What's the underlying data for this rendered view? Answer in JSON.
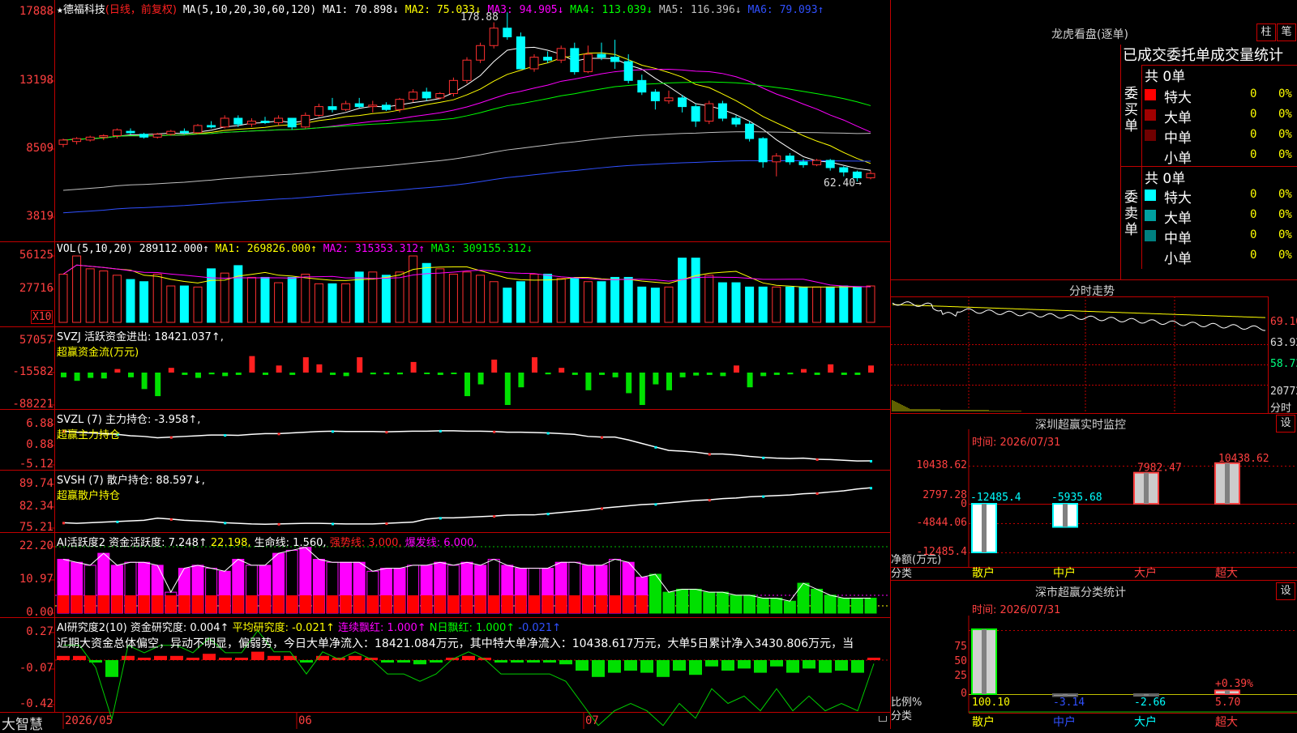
{
  "stock": {
    "star": "★",
    "name": "德福科技",
    "mode": "(日线，前复权)"
  },
  "ma_header": {
    "label": "MA(5,10,20,30,60,120)",
    "items": [
      {
        "text": "MA1: 70.898↓",
        "color": "#ffffff"
      },
      {
        "text": "MA2: 75.033↓",
        "color": "#ffff00"
      },
      {
        "text": "MA3: 94.905↓",
        "color": "#ff00ff"
      },
      {
        "text": "MA4: 113.039↓",
        "color": "#00ff00"
      },
      {
        "text": "MA5: 116.396↓",
        "color": "#c0c0c0"
      },
      {
        "text": "MA6: 79.093↑",
        "color": "#3050ff"
      }
    ]
  },
  "price_axis": [
    "17888",
    "13198",
    "8509",
    "3819"
  ],
  "price_high_mark": "178.88",
  "price_low_mark": "62.40→",
  "vol": {
    "label": "VOL(5,10,20)",
    "value": "289112.000↑",
    "ma1": "MA1: 269826.000↑",
    "ma2": "MA2: 315353.312↑",
    "ma3": "MA3: 309155.312↓",
    "axis": [
      "56125",
      "27716"
    ],
    "unit": "X10"
  },
  "svzj": {
    "label": "SVZJ  活跃资金进出: 18421.037↑,",
    "sub": "超赢资金流(万元)",
    "axis": [
      "57057",
      "-15582",
      "-88221"
    ]
  },
  "svzl": {
    "label": "SVZL (7) 主力持仓: -3.958↑,",
    "sub": "超赢主力持仓",
    "axis": [
      "6.88",
      "0.88",
      "-5.12"
    ]
  },
  "svsh": {
    "label": "SVSH (7) 散户持仓: 88.597↓,",
    "sub": "超赢散户持仓",
    "axis": [
      "89.74",
      "82.34",
      "75.21"
    ]
  },
  "ai_active": {
    "label": "AI活跃度2 资金活跃度: 7.248↑",
    "v2": "22.198,",
    "life": "生命线: 1.560,",
    "strong": "强势线: 3.000,",
    "burst": "爆发线: 6.000,",
    "axis": [
      "22.20",
      "10.97",
      "0.00"
    ]
  },
  "ai_research": {
    "label": "AI研究度2(10) 资金研究度: 0.004↑",
    "avg": "平均研究度: -0.021↑",
    "red": "连续飘红: 1.000↑",
    "nred": "N日飘红: 1.000↑",
    "last": "-0.021↑",
    "summary": "近期大资金总体偏空，异动不明显，偏弱势，今日大单净流入：18421.084万元，其中特大单净流入：10438.617万元，大单5日累计净入3430.806万元，当",
    "axis": [
      "0.27",
      "-0.07",
      "-0.42"
    ]
  },
  "bottom": {
    "brand": "大智慧",
    "dates": [
      "2026/05",
      "06",
      "07"
    ]
  },
  "dragon": {
    "title": "龙虎看盘(逐单)",
    "btn1": "柱",
    "btn2": "笔",
    "header": "已成交委托单成交量统计",
    "buy_label": "委买单",
    "sell_label": "委卖单",
    "buy_total": "共 0单",
    "sell_total": "共 0单",
    "buy_rows": [
      {
        "name": "特大",
        "qty": "0",
        "pct": "0%",
        "color": "#ff0000"
      },
      {
        "name": "大单",
        "qty": "0",
        "pct": "0%",
        "color": "#a00000"
      },
      {
        "name": "中单",
        "qty": "0",
        "pct": "0%",
        "color": "#700000"
      },
      {
        "name": "小单",
        "qty": "0",
        "pct": "0%",
        "color": "#000000"
      }
    ],
    "sell_rows": [
      {
        "name": "特大",
        "qty": "0",
        "pct": "0%",
        "color": "#00ffff"
      },
      {
        "name": "大单",
        "qty": "0",
        "pct": "0%",
        "color": "#00a0a0"
      },
      {
        "name": "中单",
        "qty": "0",
        "pct": "0%",
        "color": "#008080"
      },
      {
        "name": "小单",
        "qty": "0",
        "pct": "0%",
        "color": "#000000"
      }
    ]
  },
  "intraday": {
    "title": "分时走势",
    "axis": [
      "69.10",
      "63.92",
      "58.73",
      "20772"
    ],
    "label": "分时"
  },
  "monitor": {
    "title": "深圳超赢实时监控",
    "set": "设",
    "time": "时间: 2026/07/31",
    "axis": [
      "10438.62",
      "2797.28",
      "0",
      "-4844.06",
      "-12485.4"
    ],
    "net_label": "净额(万元)",
    "cat_label": "分类",
    "cats": [
      "散户",
      "中户",
      "大户",
      "超大"
    ],
    "values": [
      -12485.4,
      -5935.68,
      7982.47,
      10438.62
    ],
    "value_labels": [
      "-12485.4",
      "-5935.68",
      "7982.47",
      "10438.62"
    ]
  },
  "classify": {
    "title": "深市超赢分类统计",
    "set": "设",
    "time": "时间: 2026/07/31",
    "axis": [
      "75",
      "50",
      "25",
      "0"
    ],
    "ratio_label": "比例%",
    "cat_label": "分类",
    "cats": [
      "散户",
      "中户",
      "大户",
      "超大"
    ],
    "values": [
      100.1,
      -3.14,
      -2.66,
      5.7
    ],
    "value_labels": [
      "100.10",
      "-3.14",
      "-2.66",
      "5.70"
    ],
    "extra": "+0.39%"
  },
  "chart_data": [
    {
      "type": "candlestick",
      "title": "德福科技 (日线，前复权)",
      "ylim": [
        38,
        179
      ],
      "xlabels": [
        "2026/05",
        "06",
        "07"
      ],
      "ohlc": [
        [
          88,
          92,
          86,
          91
        ],
        [
          90,
          93,
          88,
          92
        ],
        [
          91,
          94,
          90,
          93
        ],
        [
          93,
          95,
          91,
          94
        ],
        [
          94,
          99,
          92,
          98
        ],
        [
          97,
          99,
          95,
          96
        ],
        [
          95,
          96,
          92,
          93
        ],
        [
          93,
          96,
          92,
          95
        ],
        [
          95,
          98,
          94,
          97
        ],
        [
          97,
          99,
          95,
          96
        ],
        [
          96,
          102,
          95,
          101
        ],
        [
          101,
          104,
          99,
          100
        ],
        [
          100,
          108,
          99,
          106
        ],
        [
          106,
          108,
          100,
          102
        ],
        [
          102,
          106,
          100,
          104
        ],
        [
          104,
          107,
          102,
          103
        ],
        [
          103,
          108,
          101,
          106
        ],
        [
          106,
          104,
          98,
          100
        ],
        [
          100,
          110,
          99,
          108
        ],
        [
          108,
          116,
          107,
          114
        ],
        [
          114,
          120,
          110,
          112
        ],
        [
          112,
          118,
          111,
          116
        ],
        [
          116,
          120,
          113,
          114
        ],
        [
          114,
          118,
          110,
          115
        ],
        [
          115,
          117,
          111,
          112
        ],
        [
          112,
          120,
          110,
          119
        ],
        [
          119,
          126,
          117,
          124
        ],
        [
          124,
          127,
          118,
          120
        ],
        [
          120,
          124,
          119,
          123
        ],
        [
          123,
          134,
          121,
          132
        ],
        [
          132,
          148,
          130,
          146
        ],
        [
          146,
          158,
          144,
          156
        ],
        [
          156,
          172,
          154,
          168
        ],
        [
          168,
          178.88,
          160,
          162
        ],
        [
          162,
          165,
          140,
          140
        ],
        [
          140,
          150,
          138,
          148
        ],
        [
          148,
          152,
          144,
          146
        ],
        [
          146,
          156,
          144,
          154
        ],
        [
          154,
          158,
          136,
          138
        ],
        [
          138,
          156,
          137,
          150
        ],
        [
          150,
          158,
          146,
          148
        ],
        [
          148,
          160,
          140,
          145
        ],
        [
          145,
          150,
          130,
          132
        ],
        [
          132,
          136,
          122,
          124
        ],
        [
          124,
          126,
          112,
          118
        ],
        [
          118,
          125,
          116,
          120
        ],
        [
          120,
          122,
          110,
          114
        ],
        [
          114,
          116,
          100,
          104
        ],
        [
          104,
          118,
          102,
          116
        ],
        [
          116,
          118,
          104,
          106
        ],
        [
          106,
          108,
          100,
          102
        ],
        [
          102,
          104,
          90,
          92
        ],
        [
          92,
          93,
          72,
          76
        ],
        [
          76,
          82,
          66,
          80
        ],
        [
          80,
          82,
          74,
          76
        ],
        [
          76,
          78,
          72,
          74
        ],
        [
          74,
          78,
          73,
          77
        ],
        [
          77,
          78,
          70,
          72
        ],
        [
          72,
          73,
          66,
          69
        ],
        [
          69,
          70,
          62.4,
          65
        ],
        [
          65,
          70,
          64,
          68
        ]
      ]
    },
    {
      "type": "bar",
      "title": "VOL(5,10,20)",
      "values": [
        45,
        62,
        50,
        48,
        44,
        40,
        38,
        45,
        34,
        34,
        33,
        50,
        46,
        53,
        42,
        42,
        37,
        42,
        45,
        36,
        36,
        36,
        47,
        47,
        44,
        47,
        62,
        55,
        50,
        45,
        47,
        44,
        38,
        32,
        38,
        45,
        45,
        41,
        41,
        38,
        38,
        42,
        42,
        33,
        32,
        33,
        60,
        60,
        44,
        37,
        37,
        33,
        33,
        33,
        33,
        33,
        33,
        33,
        34,
        33,
        34
      ]
    },
    {
      "type": "bar",
      "title": "SVZJ 活跃资金进出",
      "values": [
        -8000,
        -14000,
        -9000,
        -10000,
        6000,
        -8000,
        -28000,
        -40000,
        8000,
        -4000,
        -9000,
        -3000,
        -6000,
        -4000,
        28000,
        -4000,
        12000,
        -4000,
        26000,
        14000,
        -4000,
        -6000,
        26000,
        -3000,
        -3000,
        -3000,
        18000,
        -2000,
        -4000,
        -2000,
        -40000,
        -20000,
        22000,
        -55000,
        -25000,
        26000,
        -3000,
        8000,
        -4000,
        -30000,
        -4000,
        -8000,
        -35000,
        -55000,
        -20000,
        -30000,
        -8000,
        -5000,
        -4000,
        -6000,
        12000,
        -25000,
        -6000,
        -4000,
        -3000,
        6000,
        -4000,
        14000,
        -4000,
        -4000,
        12000
      ]
    },
    {
      "type": "line",
      "title": "SVZL 主力持仓",
      "ylim": [
        -5.12,
        6.88
      ],
      "values": [
        4.5,
        4.2,
        4.0,
        3.8,
        3.6,
        3.2,
        3.0,
        2.6,
        2.8,
        3.0,
        3.2,
        3.4,
        3.4,
        3.3,
        3.6,
        3.8,
        3.8,
        4.0,
        4.2,
        4.4,
        4.5,
        4.4,
        4.4,
        4.4,
        4.3,
        4.4,
        4.5,
        4.5,
        4.6,
        4.6,
        4.5,
        4.5,
        4.4,
        4.2,
        4.2,
        4.1,
        4.0,
        3.8,
        3.6,
        3.0,
        2.8,
        2.8,
        2.0,
        1.0,
        0.0,
        -1.0,
        -1.2,
        -1.5,
        -2.0,
        -2.0,
        -2.3,
        -2.7,
        -3.0,
        -3.2,
        -3.3,
        -3.2,
        -3.5,
        -3.6,
        -3.8,
        -4.0,
        -3.96
      ]
    },
    {
      "type": "line",
      "title": "SVSH 散户持仓",
      "ylim": [
        75.21,
        89.74
      ],
      "values": [
        77.0,
        76.8,
        77.0,
        77.2,
        77.4,
        77.6,
        77.8,
        78.5,
        78.2,
        77.8,
        77.6,
        77.4,
        77.0,
        76.8,
        76.6,
        76.5,
        76.6,
        76.7,
        76.8,
        76.8,
        76.7,
        76.6,
        76.6,
        76.6,
        76.8,
        77.0,
        77.2,
        78.2,
        78.6,
        78.6,
        78.8,
        79.0,
        79.2,
        79.5,
        79.6,
        79.6,
        80.0,
        80.4,
        80.8,
        81.2,
        81.8,
        82.2,
        82.6,
        83.0,
        83.2,
        83.6,
        84.0,
        84.4,
        84.6,
        85.0,
        85.2,
        85.6,
        85.8,
        86.0,
        86.2,
        86.6,
        86.8,
        87.2,
        87.6,
        88.2,
        88.6
      ]
    },
    {
      "type": "bar",
      "title": "AI活跃度2",
      "ylim": [
        0,
        22.2
      ],
      "values": [
        18,
        17,
        16,
        20,
        16,
        17,
        17,
        16,
        7,
        15,
        16,
        15,
        14,
        18,
        16,
        16,
        20,
        21,
        22,
        18,
        17,
        17,
        17,
        14,
        15,
        15,
        16,
        16,
        17,
        16,
        17,
        16,
        18,
        16,
        15,
        15,
        15,
        17,
        17,
        16,
        16,
        18,
        17,
        12,
        13,
        7,
        8,
        8,
        7,
        7,
        6,
        6,
        5,
        5,
        4,
        10,
        8,
        6,
        5,
        5,
        5
      ]
    },
    {
      "type": "bar",
      "title": "AI研究度2(10)",
      "ylim": [
        -0.42,
        0.27
      ],
      "values": [
        0.02,
        0.02,
        -0.01,
        -0.08,
        0.02,
        0.01,
        0.02,
        0.02,
        0.01,
        0.03,
        0.01,
        0.01,
        0.04,
        0.02,
        0.02,
        -0.01,
        0.02,
        0.01,
        0.02,
        0.01,
        -0.01,
        -0.01,
        -0.02,
        -0.01,
        0.01,
        0.02,
        0.01,
        -0.01,
        -0.01,
        -0.01,
        -0.01,
        -0.02,
        -0.05,
        -0.08,
        -0.06,
        -0.05,
        -0.06,
        -0.08,
        -0.05,
        -0.07,
        -0.03,
        -0.05,
        -0.04,
        -0.06,
        -0.03,
        -0.06,
        -0.04,
        -0.06,
        -0.05,
        -0.06,
        0.004
      ]
    },
    {
      "type": "bar",
      "title": "深圳超赢实时监控",
      "categories": [
        "散户",
        "中户",
        "大户",
        "超大"
      ],
      "values": [
        -12485.4,
        -5935.68,
        7982.47,
        10438.62
      ],
      "ylabel": "净额(万元)"
    },
    {
      "type": "bar",
      "title": "深市超赢分类统计",
      "categories": [
        "散户",
        "中户",
        "大户",
        "超大"
      ],
      "values": [
        100.1,
        -3.14,
        -2.66,
        5.7
      ],
      "ylabel": "比例%"
    }
  ]
}
